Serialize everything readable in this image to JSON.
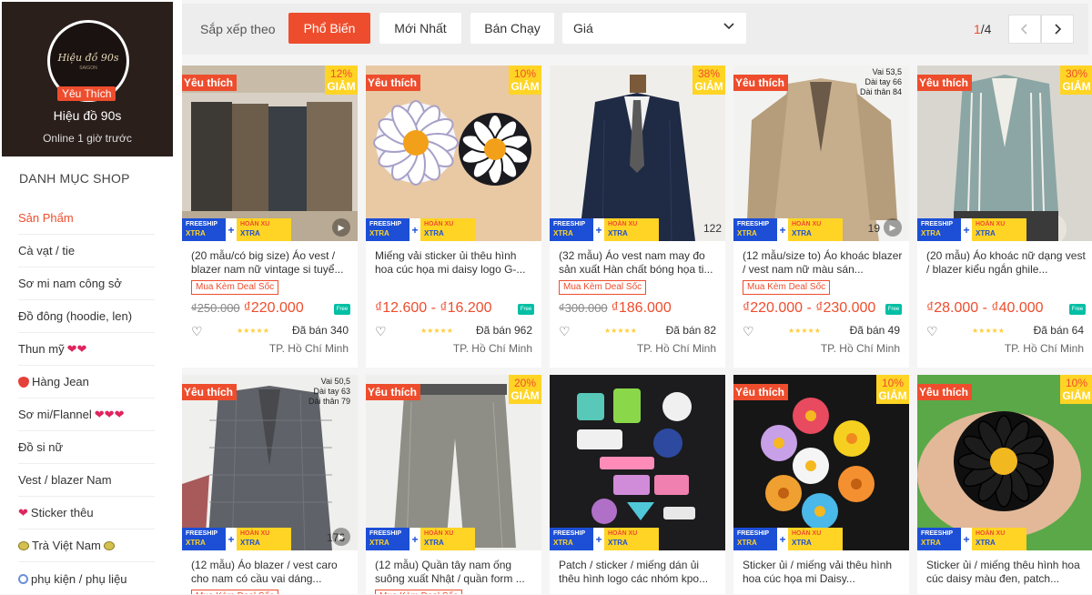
{
  "shop": {
    "logo_text": "Hiệu đồ 90s",
    "logo_sub": "SAIGON",
    "badge": "Yêu Thích",
    "name": "Hiệu đồ 90s",
    "online": "Online 1 giờ trước"
  },
  "categories": {
    "title": "DANH MỤC SHOP",
    "items": [
      {
        "label": "Sản Phẩm"
      },
      {
        "label": "Cà vạt / tie"
      },
      {
        "label": "Sơ mi nam công sở"
      },
      {
        "label": "Đồ đông (hoodie, len)"
      },
      {
        "label": "Thun mỹ"
      },
      {
        "label": "Hàng Jean"
      },
      {
        "label": "Sơ mi/Flannel"
      },
      {
        "label": "Đồ si nữ"
      },
      {
        "label": "Vest / blazer Nam"
      },
      {
        "label": "Sticker thêu"
      },
      {
        "label": "Trà Việt Nam"
      },
      {
        "label": "phụ kiện / phụ liệu"
      }
    ]
  },
  "sortbar": {
    "label": "Sắp xếp theo",
    "popular": "Phổ Biến",
    "newest": "Mới Nhất",
    "best": "Bán Chạy",
    "price": "Giá",
    "page_current": "1",
    "page_total": "/4"
  },
  "badges": {
    "fav": "Yêu thích",
    "off": "GIẢM",
    "freeship": "FREESHIP",
    "xtra": "XTRA",
    "hoanxu": "HOÀN XU",
    "deal": "Mua Kèm Deal Sốc",
    "free": "Free"
  },
  "products": [
    {
      "name": "(20 mẫu/có big size) Áo vest / blazer nam nữ vintage si tuyể...",
      "old": "₫250.000",
      "price": "₫220.000",
      "discount": "12%",
      "rating": 5,
      "sold": "Đã bán 340",
      "loc": "TP. Hồ Chí Minh"
    },
    {
      "name": "Miếng vải sticker ủi thêu hình hoa cúc họa mi daisy logo G-...",
      "old": "",
      "price": "₫12.600 - ₫16.200",
      "discount": "10%",
      "rating": 5,
      "sold": "Đã bán 962",
      "loc": "TP. Hồ Chí Minh"
    },
    {
      "name": "(32 mẫu) Áo vest nam may đo sản xuất Hàn chất bóng họa ti...",
      "old": "₫300.000",
      "price": "₫186.000",
      "discount": "38%",
      "rating": 5,
      "sold": "Đã bán 82",
      "loc": "TP. Hồ Chí Minh",
      "img_num": "122"
    },
    {
      "name": "(12 mẫu/size to) Áo khoác blazer / vest nam nữ màu sán...",
      "old": "",
      "price": "₫220.000 - ₫230.000",
      "discount": "",
      "rating": 5,
      "sold": "Đã bán 49",
      "loc": "TP. Hồ Chí Minh",
      "img_num": "19",
      "tag": "Vai 53,5\nDài tay 66\nDài thân 84"
    },
    {
      "name": "(20 mẫu) Áo khoác nữ dạng vest / blazer kiểu ngắn ghile...",
      "old": "",
      "price": "₫28.000 - ₫40.000",
      "discount": "30%",
      "rating": 5,
      "sold": "Đã bán 64",
      "loc": "TP. Hồ Chí Minh"
    },
    {
      "name": "(12 mẫu) Áo blazer / vest caro cho nam có cầu vai dáng...",
      "discount": "",
      "img_num": "176",
      "tag": "Vai 50,5\nDài tay 63\nDài thân 79"
    },
    {
      "name": "(12 mẫu) Quần tây nam ống suông xuất Nhật / quần form ...",
      "discount": "20%"
    },
    {
      "name": "Patch / sticker / miếng dán ủi thêu hình logo các nhóm kpo...",
      "discount": ""
    },
    {
      "name": "Sticker ủi / miếng vải thêu hình hoa cúc họa mi Daisy...",
      "discount": "10%"
    },
    {
      "name": "Sticker ủi / miếng thêu hình hoa cúc daisy màu đen, patch...",
      "discount": "10%"
    }
  ],
  "colors": {
    "accent": "#ee4d2d",
    "yellow": "#ffd424",
    "blue": "#1c4fd6"
  }
}
